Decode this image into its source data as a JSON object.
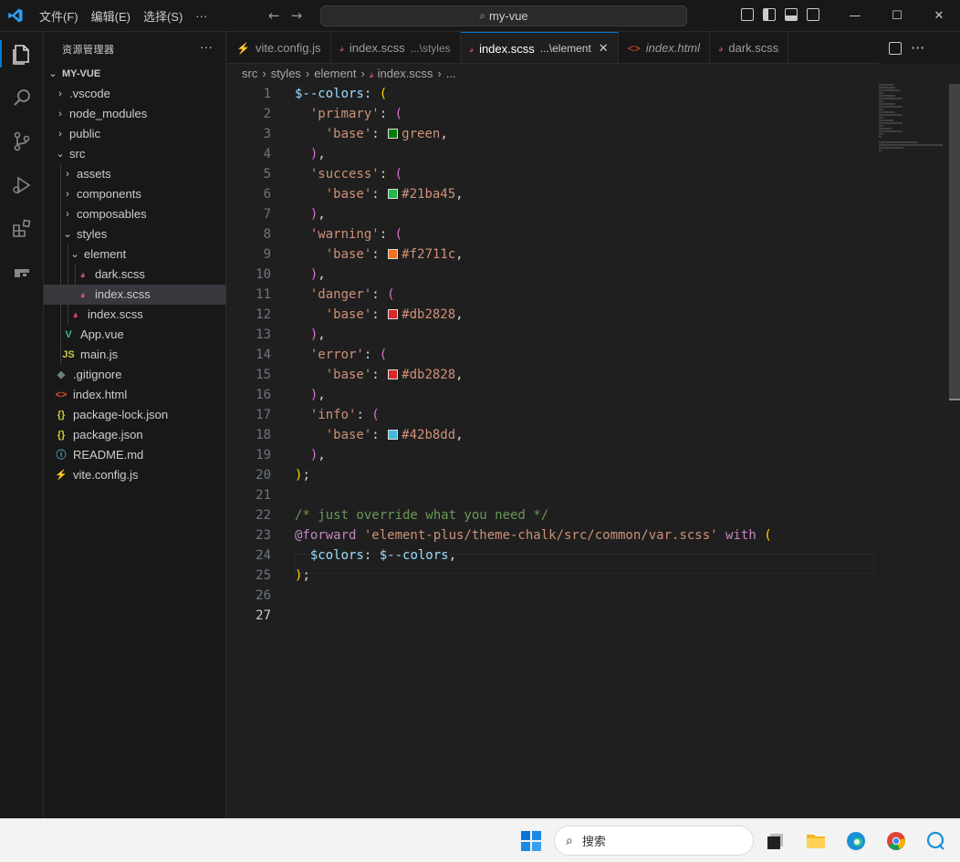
{
  "titlebar": {
    "menu": [
      "文件(F)",
      "编辑(E)",
      "选择(S)",
      "···"
    ],
    "search": "my-vue",
    "window_controls": [
      "minimize-icon",
      "maximize-icon",
      "close-icon"
    ]
  },
  "activity_bar": {
    "icons": [
      "explorer-icon",
      "search-icon",
      "source-control-icon",
      "run-debug-icon",
      "extensions-icon",
      "remote-icon"
    ]
  },
  "sidebar": {
    "title": "资源管理器",
    "more": "···",
    "root": "MY-VUE",
    "items": [
      {
        "label": ".vscode",
        "kind": "folder",
        "expanded": false,
        "depth": 1
      },
      {
        "label": "node_modules",
        "kind": "folder",
        "expanded": false,
        "depth": 1
      },
      {
        "label": "public",
        "kind": "folder",
        "expanded": false,
        "depth": 1
      },
      {
        "label": "src",
        "kind": "folder",
        "expanded": true,
        "depth": 1
      },
      {
        "label": "assets",
        "kind": "folder",
        "expanded": false,
        "depth": 2
      },
      {
        "label": "components",
        "kind": "folder",
        "expanded": false,
        "depth": 2
      },
      {
        "label": "composables",
        "kind": "folder",
        "expanded": false,
        "depth": 2
      },
      {
        "label": "styles",
        "kind": "folder",
        "expanded": true,
        "depth": 2
      },
      {
        "label": "element",
        "kind": "folder",
        "expanded": true,
        "depth": 3
      },
      {
        "label": "dark.scss",
        "kind": "scss",
        "depth": 4
      },
      {
        "label": "index.scss",
        "kind": "scss",
        "depth": 4,
        "selected": true
      },
      {
        "label": "index.scss",
        "kind": "scss",
        "depth": 3
      },
      {
        "label": "App.vue",
        "kind": "vue",
        "depth": 2
      },
      {
        "label": "main.js",
        "kind": "js",
        "depth": 2
      },
      {
        "label": ".gitignore",
        "kind": "git",
        "depth": 1
      },
      {
        "label": "index.html",
        "kind": "html",
        "depth": 1
      },
      {
        "label": "package-lock.json",
        "kind": "json",
        "depth": 1
      },
      {
        "label": "package.json",
        "kind": "json",
        "depth": 1
      },
      {
        "label": "README.md",
        "kind": "info",
        "depth": 1
      },
      {
        "label": "vite.config.js",
        "kind": "vite",
        "depth": 1
      }
    ]
  },
  "tabs": [
    {
      "name": "vite.config.js",
      "desc": "",
      "kind": "vite",
      "active": false,
      "italic": false
    },
    {
      "name": "index.scss",
      "desc": "...\\styles",
      "kind": "scss",
      "active": false,
      "italic": false
    },
    {
      "name": "index.scss",
      "desc": "...\\element",
      "kind": "scss",
      "active": true,
      "italic": false
    },
    {
      "name": "index.html",
      "desc": "",
      "kind": "html",
      "active": false,
      "italic": true
    },
    {
      "name": "dark.scss",
      "desc": "",
      "kind": "scss",
      "active": false,
      "italic": false
    }
  ],
  "breadcrumb": [
    "src",
    "styles",
    "element",
    "index.scss",
    "..."
  ],
  "code": {
    "current_line": 27,
    "lines": [
      [
        [
          "var",
          "$--colors"
        ],
        [
          "op",
          ": "
        ],
        [
          "p1",
          "("
        ]
      ],
      [
        [
          "plain",
          "  "
        ],
        [
          "str",
          "'primary'"
        ],
        [
          "op",
          ": "
        ],
        [
          "p2",
          "("
        ]
      ],
      [
        [
          "plain",
          "    "
        ],
        [
          "str",
          "'base'"
        ],
        [
          "op",
          ": "
        ],
        [
          "sw",
          "#008000"
        ],
        [
          "val",
          "green"
        ],
        [
          "op",
          ","
        ]
      ],
      [
        [
          "plain",
          "  "
        ],
        [
          "p2",
          ")"
        ],
        [
          "op",
          ","
        ]
      ],
      [
        [
          "plain",
          "  "
        ],
        [
          "str",
          "'success'"
        ],
        [
          "op",
          ": "
        ],
        [
          "p2",
          "("
        ]
      ],
      [
        [
          "plain",
          "    "
        ],
        [
          "str",
          "'base'"
        ],
        [
          "op",
          ": "
        ],
        [
          "sw",
          "#21ba45"
        ],
        [
          "val",
          "#21ba45"
        ],
        [
          "op",
          ","
        ]
      ],
      [
        [
          "plain",
          "  "
        ],
        [
          "p2",
          ")"
        ],
        [
          "op",
          ","
        ]
      ],
      [
        [
          "plain",
          "  "
        ],
        [
          "str",
          "'warning'"
        ],
        [
          "op",
          ": "
        ],
        [
          "p2",
          "("
        ]
      ],
      [
        [
          "plain",
          "    "
        ],
        [
          "str",
          "'base'"
        ],
        [
          "op",
          ": "
        ],
        [
          "sw",
          "#f2711c"
        ],
        [
          "val",
          "#f2711c"
        ],
        [
          "op",
          ","
        ]
      ],
      [
        [
          "plain",
          "  "
        ],
        [
          "p2",
          ")"
        ],
        [
          "op",
          ","
        ]
      ],
      [
        [
          "plain",
          "  "
        ],
        [
          "str",
          "'danger'"
        ],
        [
          "op",
          ": "
        ],
        [
          "p2",
          "("
        ]
      ],
      [
        [
          "plain",
          "    "
        ],
        [
          "str",
          "'base'"
        ],
        [
          "op",
          ": "
        ],
        [
          "sw",
          "#db2828"
        ],
        [
          "val",
          "#db2828"
        ],
        [
          "op",
          ","
        ]
      ],
      [
        [
          "plain",
          "  "
        ],
        [
          "p2",
          ")"
        ],
        [
          "op",
          ","
        ]
      ],
      [
        [
          "plain",
          "  "
        ],
        [
          "str",
          "'error'"
        ],
        [
          "op",
          ": "
        ],
        [
          "p2",
          "("
        ]
      ],
      [
        [
          "plain",
          "    "
        ],
        [
          "str",
          "'base'"
        ],
        [
          "op",
          ": "
        ],
        [
          "sw",
          "#db2828"
        ],
        [
          "val",
          "#db2828"
        ],
        [
          "op",
          ","
        ]
      ],
      [
        [
          "plain",
          "  "
        ],
        [
          "p2",
          ")"
        ],
        [
          "op",
          ","
        ]
      ],
      [
        [
          "plain",
          "  "
        ],
        [
          "str",
          "'info'"
        ],
        [
          "op",
          ": "
        ],
        [
          "p2",
          "("
        ]
      ],
      [
        [
          "plain",
          "    "
        ],
        [
          "str",
          "'base'"
        ],
        [
          "op",
          ": "
        ],
        [
          "sw",
          "#42b8dd"
        ],
        [
          "val",
          "#42b8dd"
        ],
        [
          "op",
          ","
        ]
      ],
      [
        [
          "plain",
          "  "
        ],
        [
          "p2",
          ")"
        ],
        [
          "op",
          ","
        ]
      ],
      [
        [
          "p1",
          ")"
        ],
        [
          "op",
          ";"
        ]
      ],
      [],
      [
        [
          "cm",
          "/* just override what you need */"
        ]
      ],
      [
        [
          "kw",
          "@forward "
        ],
        [
          "str",
          "'element-plus/theme-chalk/src/common/var.scss'"
        ],
        [
          "op",
          " "
        ],
        [
          "kw",
          "with"
        ],
        [
          "op",
          " "
        ],
        [
          "p1",
          "("
        ]
      ],
      [
        [
          "plain",
          "  "
        ],
        [
          "var",
          "$colors"
        ],
        [
          "op",
          ": "
        ],
        [
          "var",
          "$--colors"
        ],
        [
          "op",
          ","
        ]
      ],
      [
        [
          "p1",
          ")"
        ],
        [
          "op",
          ";"
        ]
      ],
      [],
      []
    ]
  },
  "taskbar": {
    "search_placeholder": "搜索",
    "apps": [
      "task-view-icon",
      "file-explorer-icon",
      "edge-icon",
      "chrome-icon",
      "chat-icon"
    ]
  },
  "colors": {
    "accent": "#0078d4"
  }
}
